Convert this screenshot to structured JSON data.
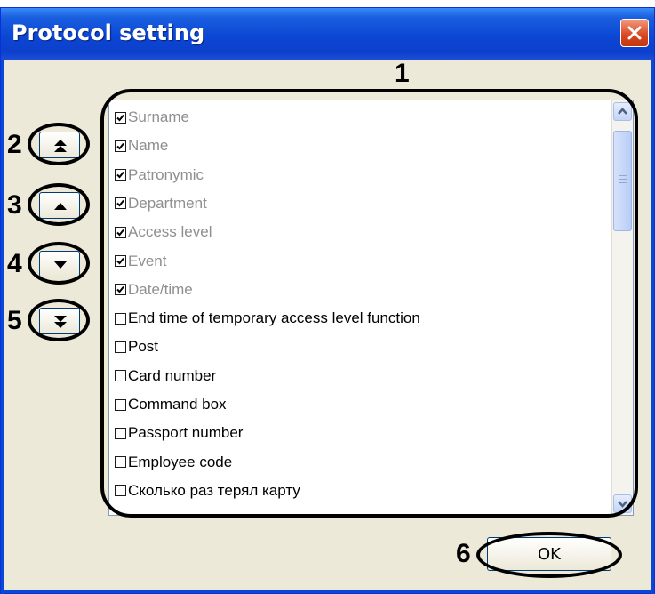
{
  "window": {
    "title": "Protocol setting"
  },
  "callouts": {
    "n1": "1",
    "n2": "2",
    "n3": "3",
    "n4": "4",
    "n5": "5",
    "n6": "6"
  },
  "fields": [
    {
      "label": "Surname",
      "checked": true,
      "disabled": true
    },
    {
      "label": "Name",
      "checked": true,
      "disabled": true
    },
    {
      "label": "Patronymic",
      "checked": true,
      "disabled": true
    },
    {
      "label": "Department",
      "checked": true,
      "disabled": true
    },
    {
      "label": "Access level",
      "checked": true,
      "disabled": true
    },
    {
      "label": "Event",
      "checked": true,
      "disabled": true
    },
    {
      "label": "Date/time",
      "checked": true,
      "disabled": true
    },
    {
      "label": "End time of temporary access level function",
      "checked": false,
      "disabled": false
    },
    {
      "label": "Post",
      "checked": false,
      "disabled": false
    },
    {
      "label": "Card number",
      "checked": false,
      "disabled": false
    },
    {
      "label": "Command box",
      "checked": false,
      "disabled": false
    },
    {
      "label": "Passport number",
      "checked": false,
      "disabled": false
    },
    {
      "label": "Employee code",
      "checked": false,
      "disabled": false
    },
    {
      "label": "Сколько раз терял карту",
      "checked": false,
      "disabled": false
    }
  ],
  "buttons": {
    "ok_label": "OK",
    "move_top_icon": "double-chevron-up-icon",
    "move_up_icon": "chevron-up-icon",
    "move_down_icon": "chevron-down-icon",
    "move_bottom_icon": "double-chevron-down-icon"
  },
  "colors": {
    "titlebar": "#0b47d4",
    "close": "#d8461f",
    "dialog_bg": "#ece9d8"
  }
}
